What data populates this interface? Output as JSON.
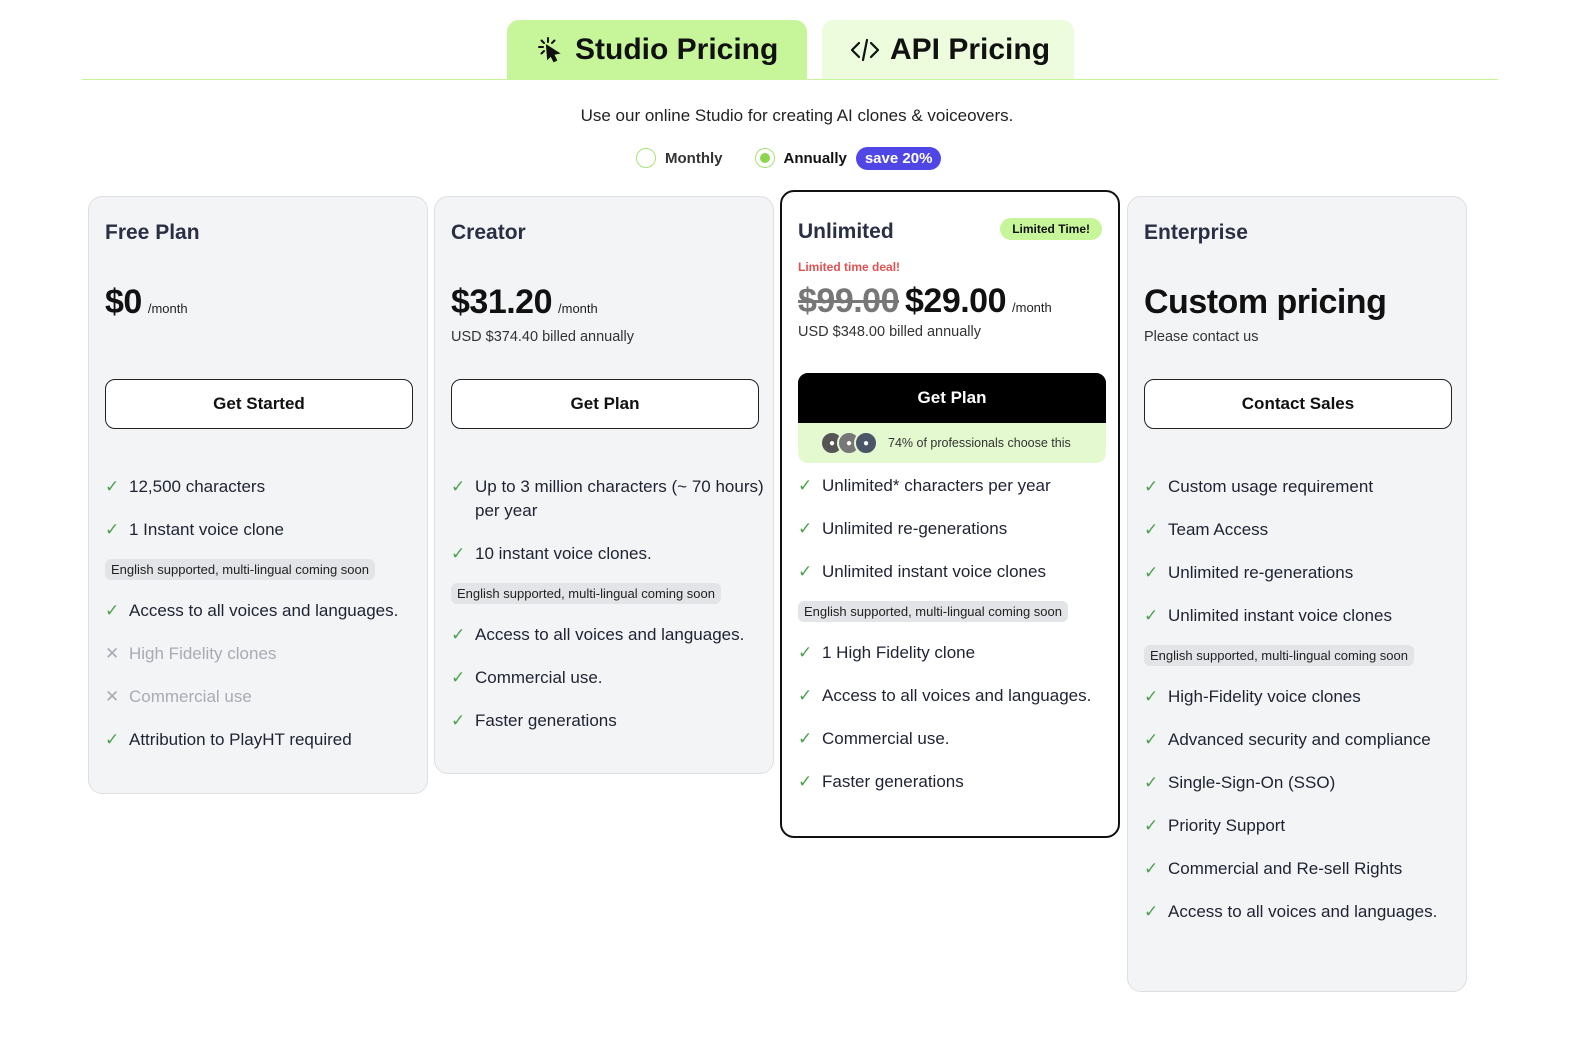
{
  "tabs": [
    {
      "label": "Studio Pricing",
      "icon": "cursor-click-icon",
      "active": true
    },
    {
      "label": "API Pricing",
      "icon": "code-icon",
      "active": false
    }
  ],
  "subtitle": "Use our online Studio for creating AI clones & voiceovers.",
  "billing": {
    "monthly_label": "Monthly",
    "annual_label": "Annually",
    "save_badge": "save 20%",
    "selected": "Annually"
  },
  "colors": {
    "accent": "#c6f59a",
    "badge": "#4f46e5",
    "deal": "#e05252",
    "check": "#4ca24c"
  },
  "plans": [
    {
      "name": "Free Plan",
      "price": "$0",
      "per": "/month",
      "billed": "",
      "cta": "Get Started",
      "features": [
        {
          "text": "12,500 characters",
          "included": true
        },
        {
          "text": "1 Instant voice clone",
          "included": true,
          "note": "English supported, multi-lingual coming soon"
        },
        {
          "text": "Access to all voices and languages.",
          "included": true
        },
        {
          "text": "High Fidelity clones",
          "included": false
        },
        {
          "text": "Commercial use",
          "included": false
        },
        {
          "text": "Attribution to PlayHT required",
          "included": true
        }
      ]
    },
    {
      "name": "Creator",
      "price": "$31.20",
      "per": "/month",
      "billed": "USD $374.40 billed annually",
      "cta": "Get Plan",
      "features": [
        {
          "text": "Up to 3 million characters (~ 70 hours) per year",
          "included": true
        },
        {
          "text": "10 instant voice clones.",
          "included": true,
          "note": "English supported, multi-lingual coming soon"
        },
        {
          "text": "Access to all voices and languages.",
          "included": true
        },
        {
          "text": "Commercial use.",
          "included": true
        },
        {
          "text": "Faster generations",
          "included": true
        }
      ]
    },
    {
      "name": "Unlimited",
      "badge": "Limited Time!",
      "deal": "Limited time deal!",
      "old_price": "$99.00",
      "price": "$29.00",
      "per": "/month",
      "billed": "USD $348.00 billed annually",
      "cta": "Get Plan",
      "social_proof": "74% of professionals choose this",
      "features": [
        {
          "text": "Unlimited* characters per year",
          "included": true
        },
        {
          "text": "Unlimited re-generations",
          "included": true
        },
        {
          "text": "Unlimited instant voice clones",
          "included": true,
          "note": "English supported, multi-lingual coming soon"
        },
        {
          "text": "1 High Fidelity clone",
          "included": true
        },
        {
          "text": "Access to all voices and languages.",
          "included": true
        },
        {
          "text": "Commercial use.",
          "included": true
        },
        {
          "text": "Faster generations",
          "included": true
        }
      ]
    },
    {
      "name": "Enterprise",
      "price": "Custom pricing",
      "billed": "Please contact us",
      "cta": "Contact Sales",
      "features": [
        {
          "text": "Custom usage requirement",
          "included": true
        },
        {
          "text": "Team Access",
          "included": true
        },
        {
          "text": "Unlimited re-generations",
          "included": true
        },
        {
          "text": "Unlimited instant voice clones",
          "included": true,
          "note": "English supported, multi-lingual coming soon"
        },
        {
          "text": "High-Fidelity voice clones",
          "included": true
        },
        {
          "text": "Advanced security and compliance",
          "included": true
        },
        {
          "text": "Single-Sign-On (SSO)",
          "included": true
        },
        {
          "text": "Priority Support",
          "included": true
        },
        {
          "text": "Commercial and Re-sell Rights",
          "included": true
        },
        {
          "text": "Access to all voices and languages.",
          "included": true
        }
      ]
    }
  ]
}
